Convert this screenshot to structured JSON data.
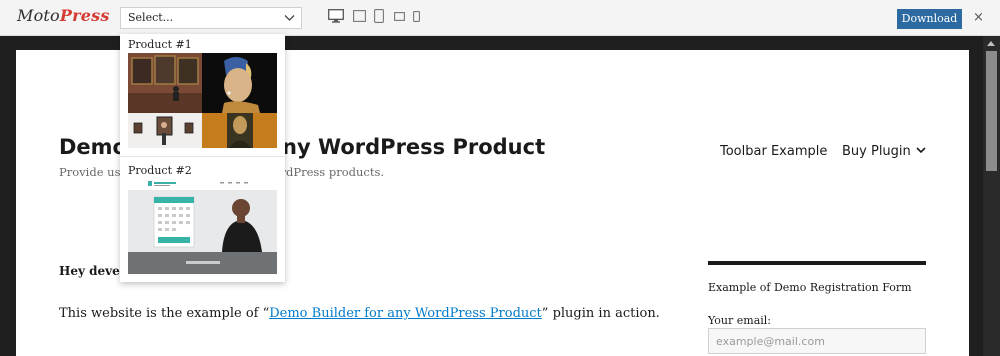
{
  "toolbar": {
    "logo_part1": "Moto",
    "logo_part2": "Press",
    "select_value": "Select...",
    "devices": [
      "desktop-icon",
      "laptop-icon",
      "tablet-portrait-icon",
      "tablet-landscape-icon",
      "phone-icon"
    ],
    "download_label": "Download",
    "close_label": "×"
  },
  "dropdown": {
    "items": [
      {
        "label": "Product #1",
        "thumbnail": "art-gallery-thumbnail"
      },
      {
        "label": "Product #2",
        "thumbnail": "business-site-thumbnail"
      }
    ]
  },
  "site": {
    "title": "Demo Builder for any WordPress Product",
    "description": "Provide users with a demo of your WordPress products.",
    "nav": [
      {
        "label": "Toolbar Example"
      },
      {
        "label": "Buy Plugin"
      }
    ],
    "greeting": "Hey developers!",
    "paragraph_before": "This website is the example of “",
    "paragraph_link": "Demo Builder for any WordPress Product",
    "paragraph_after": "” plugin in action."
  },
  "sidebar": {
    "widget_title": "Example of Demo Registration Form",
    "email_label": "Your email:",
    "email_placeholder": "example@mail.com"
  },
  "colors": {
    "brand_red": "#d63b33",
    "download_blue": "#2c6aa1",
    "link_blue": "#007acc"
  }
}
